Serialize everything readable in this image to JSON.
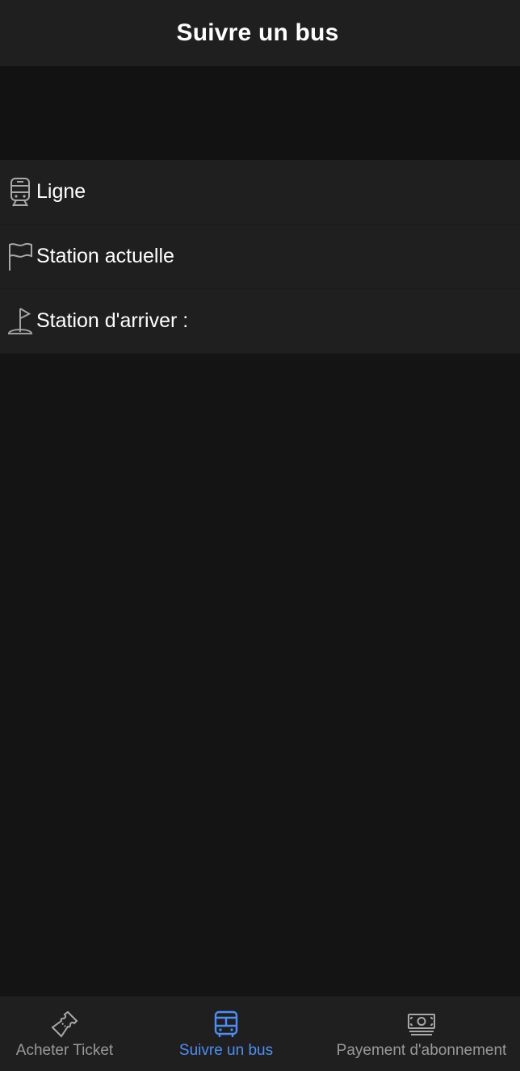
{
  "header": {
    "title": "Suivre un bus"
  },
  "list": {
    "items": [
      {
        "label": "Ligne",
        "icon": "train-icon"
      },
      {
        "label": "Station actuelle",
        "icon": "flag-icon"
      },
      {
        "label": "Station d'arriver :",
        "icon": "golf-flag-icon"
      }
    ]
  },
  "bottom_nav": {
    "items": [
      {
        "label": "Acheter Ticket",
        "icon": "ticket-icon",
        "active": false
      },
      {
        "label": "Suivre un bus",
        "icon": "bus-icon",
        "active": true
      },
      {
        "label": "Payement d'abonnement",
        "icon": "money-icon",
        "active": false
      }
    ]
  },
  "colors": {
    "accent": "#4d8ff5",
    "background": "#141414",
    "surface": "#1f1f1f",
    "inactive": "#9a9a9a"
  }
}
